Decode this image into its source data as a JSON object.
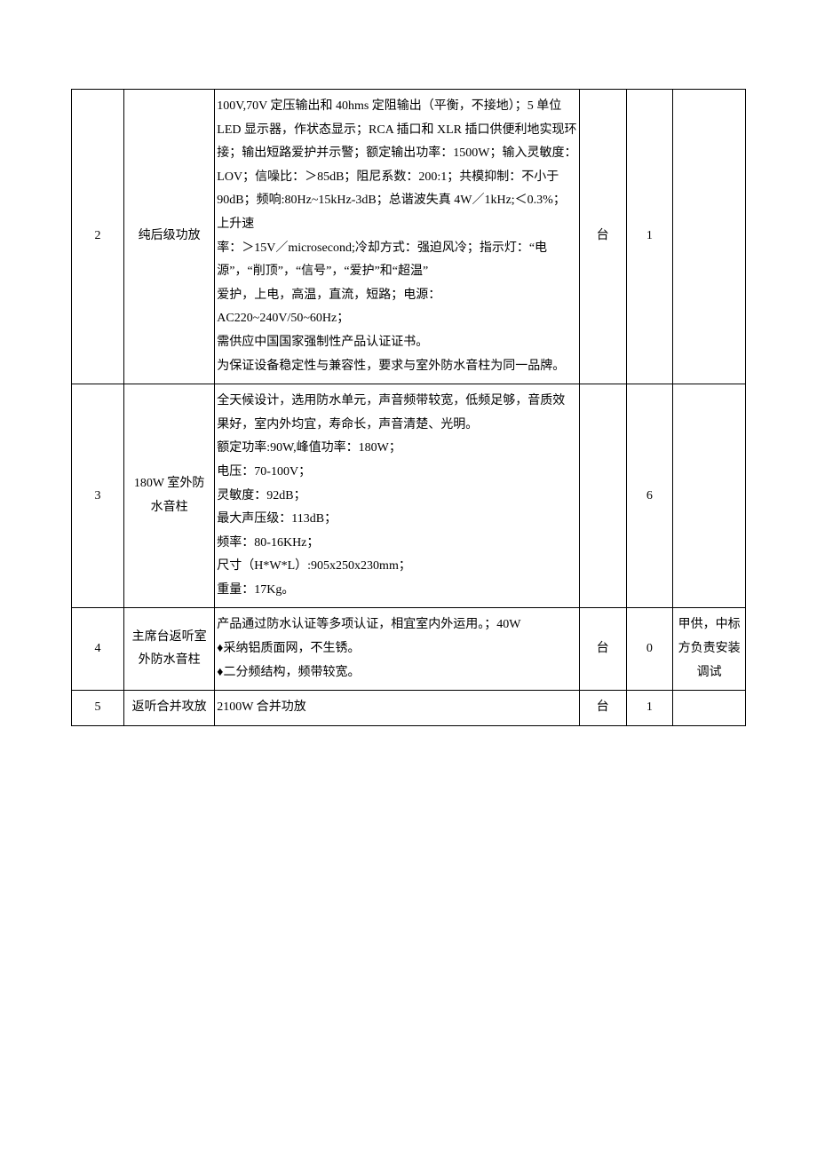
{
  "rows": [
    {
      "idx": "2",
      "name": "纯后级功放",
      "desc": "100V,70V 定压输出和 40hms 定阻输出（平衡，不接地）；5 单位 LED 显示器，作状态显示；RCA 插口和 XLR 插口供便利地实现环接；输出短路爱护并示警；额定输出功率：1500W；输入灵敏度：LOV；信噪比：＞85dB；阻尼系数：200:1；共模抑制：不小于 90dB；频响:80Hz~15kHz-3dB；总谐波失真 4W／1kHz;＜0.3%；上升速\n率：＞15V／microsecond;冷却方式：强迫风冷；指示灯：“电源”，“削顶”，“信号”，“爱护”和“超温”\n爱护，上电，高温，直流，短路；电源：\nAC220~240V/50~60Hz；\n需供应中国国家强制性产品认证证书。\n为保证设备稳定性与兼容性，要求与室外防水音柱为同一品牌。",
      "unit": "台",
      "qty": "1",
      "note": ""
    },
    {
      "idx": "3",
      "name": "180W 室外防水音柱",
      "desc": "全天候设计，选用防水单元，声音频带较宽，低频足够，音质效果好，室内外均宜，寿命长，声音清楚、光明。\n额定功率:90W,峰值功率：180W；\n电压：70-100V；\n灵敏度：92dB；\n最大声压级：113dB；\n频率：80-16KHz；\n尺寸（H*W*L）:905x250x230mm；\n重量：17Kg。",
      "unit": "",
      "qty": "6",
      "note": ""
    },
    {
      "idx": "4",
      "name": "主席台返听室外防水音柱",
      "desc": "产品通过防水认证等多项认证，相宜室内外运用。；40W\n♦采纳铝质面网，不生锈。\n♦二分频结构，频带较宽。",
      "unit": "台",
      "qty": "0",
      "note": "甲供，中标方负责安装调试"
    },
    {
      "idx": "5",
      "name": "返听合并攻放",
      "desc": "2100W 合并功放",
      "unit": "台",
      "qty": "1",
      "note": ""
    }
  ]
}
